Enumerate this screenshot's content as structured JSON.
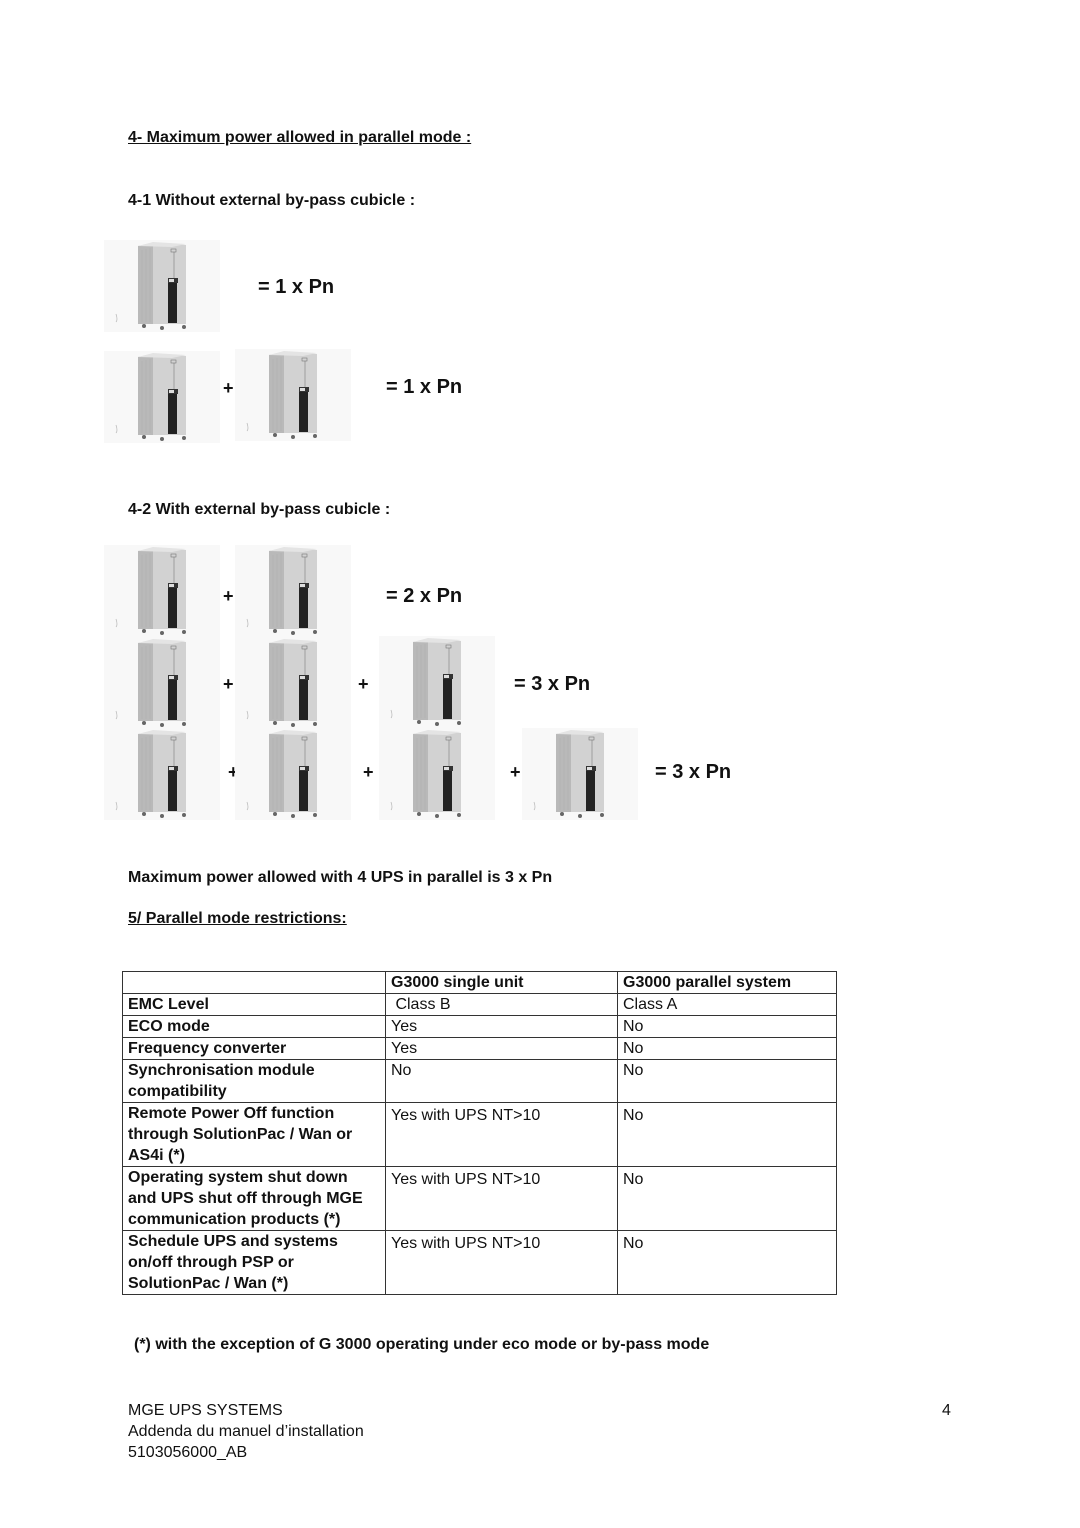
{
  "section4": {
    "title": "4- Maximum power allowed in parallel mode :",
    "sub1": {
      "title": "4-1 Without external by-pass cubicle :",
      "rows": [
        {
          "units": 1,
          "plus_signs": [],
          "result": "= 1 x Pn"
        },
        {
          "units": 2,
          "plus_signs": [
            "+"
          ],
          "result": "= 1 x Pn"
        }
      ]
    },
    "sub2": {
      "title": "4-2 With external by-pass cubicle :",
      "rows": [
        {
          "units": 2,
          "plus_signs": [
            "+"
          ],
          "result": "= 2 x Pn"
        },
        {
          "units": 3,
          "plus_signs": [
            "+",
            "+"
          ],
          "result": "= 3 x Pn"
        },
        {
          "units": 4,
          "plus_signs": [
            "+",
            "+",
            "+"
          ],
          "result": "= 3 x Pn"
        }
      ]
    },
    "conclusion": "Maximum power allowed with 4 UPS in parallel is 3 x Pn"
  },
  "section5": {
    "title": "5/ Parallel mode restrictions:",
    "table": {
      "headers": [
        "",
        "G3000 single unit",
        "G3000 parallel system"
      ],
      "rows": [
        {
          "feature": "EMC Level",
          "single": " Class B",
          "parallel": "Class A"
        },
        {
          "feature": "ECO mode",
          "single": "Yes",
          "parallel": "No"
        },
        {
          "feature": "Frequency converter",
          "single": "Yes",
          "parallel": "No"
        },
        {
          "feature": "Synchronisation module compatibility",
          "single": "No",
          "parallel": "No"
        },
        {
          "feature": "Remote Power Off function through SolutionPac / Wan or AS4i (*)",
          "single": "Yes with UPS NT>10",
          "parallel": "No"
        },
        {
          "feature": "Operating system shut down and UPS shut off through MGE communication products (*)",
          "single": "Yes with UPS NT>10",
          "parallel": "No"
        },
        {
          "feature": "Schedule UPS and systems on/off through PSP or SolutionPac / Wan (*)",
          "single": "Yes with UPS NT>10",
          "parallel": "No"
        }
      ]
    },
    "footnote": "(*) with the exception of G 3000 operating under eco mode or by-pass mode"
  },
  "footer": {
    "company": "MGE UPS SYSTEMS",
    "doc_title": "Addenda du manuel d’installation",
    "doc_ref": "5103056000_AB",
    "page_number": "4"
  },
  "icons": {
    "ups_cabinet": "ups-cabinet-image"
  }
}
